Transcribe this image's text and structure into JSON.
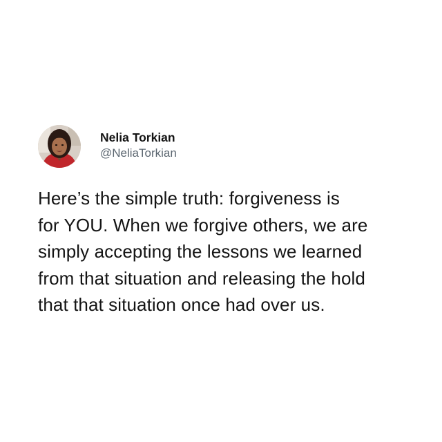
{
  "tweet": {
    "author": {
      "display_name": "Nelia Torkian",
      "handle": "@NeliaTorkian",
      "avatar": "profile-photo"
    },
    "text_lines": [
      "Here’s the simple truth: forgiveness is",
      "for YOU. When we forgive others, we are",
      "simply accepting the lessons we learned",
      "from that situation and releasing the hold",
      "that that situation once had over us."
    ]
  },
  "colors": {
    "background": "#ffffff",
    "text": "#141414",
    "handle": "#5b6670"
  }
}
